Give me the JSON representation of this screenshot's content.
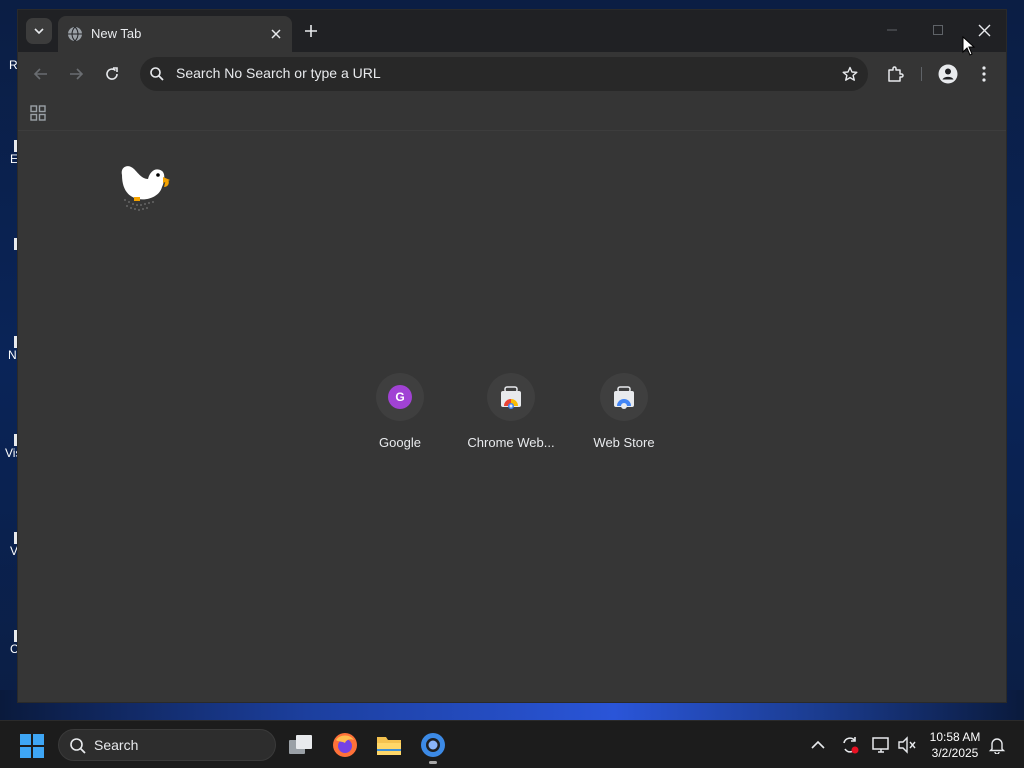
{
  "colors": {
    "window_bg": "#353535",
    "tabstrip_bg": "#202124",
    "omnibox_bg": "#282828",
    "ntp_bg": "#363636",
    "google_avatar": "#a142d4",
    "taskbar_bg": "#1c1c1c"
  },
  "desktop": {
    "icons": [
      {
        "label": "R"
      },
      {
        "label": "E"
      },
      {
        "label": ""
      },
      {
        "label": "N"
      },
      {
        "label": "Vis"
      },
      {
        "label": "V"
      },
      {
        "label": "C"
      }
    ]
  },
  "browser": {
    "tab": {
      "title": "New Tab",
      "favicon": "globe-icon"
    },
    "omnibox": {
      "placeholder": "Search No Search or type a URL"
    },
    "shortcuts": [
      {
        "label": "Google",
        "icon_letter": "G",
        "icon": "google-letter-icon"
      },
      {
        "label": "Chrome Web...",
        "icon": "chrome-web-store-icon"
      },
      {
        "label": "Web Store",
        "icon": "web-store-icon"
      }
    ]
  },
  "taskbar": {
    "search_label": "Search",
    "apps": [
      {
        "name": "task-view",
        "icon": "task-view-icon"
      },
      {
        "name": "firefox",
        "icon": "firefox-icon"
      },
      {
        "name": "file-explorer",
        "icon": "folder-icon"
      },
      {
        "name": "chrome",
        "icon": "chrome-icon",
        "active": true
      }
    ],
    "clock": {
      "time": "10:58 AM",
      "date": "3/2/2025"
    }
  }
}
